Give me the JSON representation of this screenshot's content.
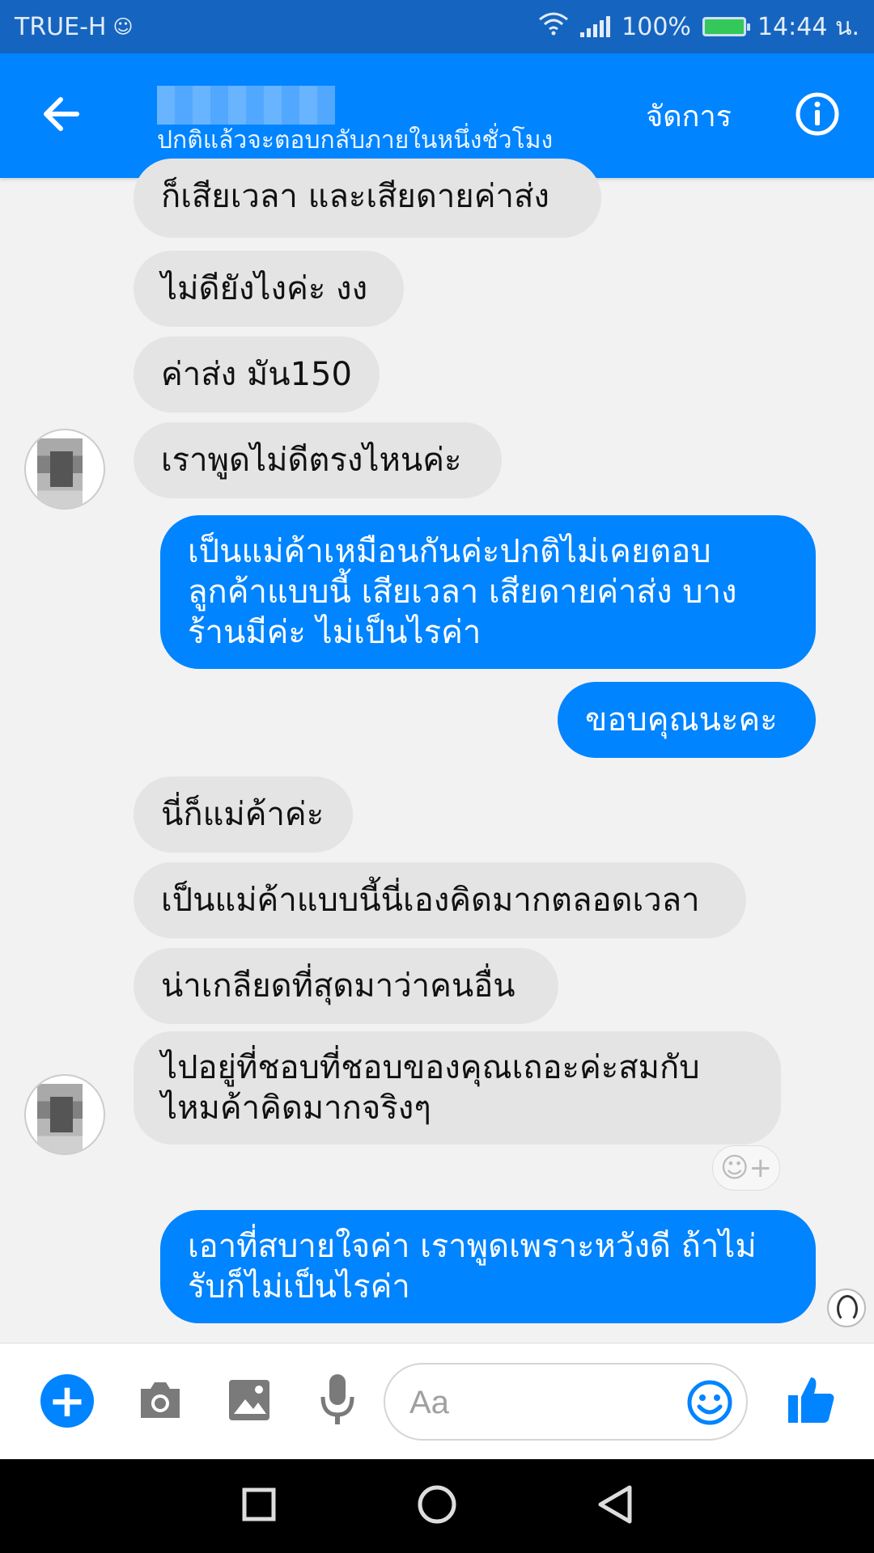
{
  "status_bar": {
    "carrier": "TRUE-H",
    "battery": "100%",
    "time": "14:44 น."
  },
  "header": {
    "subtitle": "ปกติแล้วจะตอบกลับภายในหนึ่งชั่วโมง",
    "manage_label": "จัดการ",
    "icons": [
      "back-arrow-icon",
      "info-icon"
    ]
  },
  "messages": [
    {
      "side": "in",
      "text": "ก็เสียเวลา และเสียดายค่าส่ง"
    },
    {
      "side": "in",
      "text": "ไม่ดียังไงค่ะ งง"
    },
    {
      "side": "in",
      "text": "ค่าส่ง มัน150"
    },
    {
      "side": "in",
      "text": "เราพูดไม่ดีตรงไหนค่ะ"
    },
    {
      "side": "out",
      "lines": [
        "เป็นแม่ค้าเหมือนกันค่ะปกติไม่เคยตอบ",
        "ลูกค้าแบบนี้ เสียเวลา เสียดายค่าส่ง บาง",
        "ร้านมีค่ะ ไม่เป็นไรค่า"
      ]
    },
    {
      "side": "out",
      "text": "ขอบคุณนะคะ"
    },
    {
      "side": "in",
      "text": "นี่ก็แม่ค้าค่ะ"
    },
    {
      "side": "in",
      "text": "เป็นแม่ค้าแบบนี้นี่เองคิดมากตลอดเวลา"
    },
    {
      "side": "in",
      "text": "น่าเกลียดที่สุดมาว่าคนอื่น"
    },
    {
      "side": "in",
      "lines": [
        "ไปอยู่ที่ชอบที่ชอบของคุณเถอะค่ะสมกับ",
        "ไหมค้าคิดมากจริงๆ"
      ]
    },
    {
      "side": "out",
      "lines": [
        "เอาที่สบายใจค่า เราพูดเพราะหวังดี ถ้าไม่",
        "รับก็ไม่เป็นไรค่า"
      ]
    }
  ],
  "composer": {
    "placeholder": "Aa",
    "icons": [
      "plus-icon",
      "camera-icon",
      "image-icon",
      "microphone-icon",
      "emoji-icon",
      "thumbs-up-icon"
    ]
  },
  "colors": {
    "status_bar": "#1565c0",
    "header": "#0084ff",
    "outgoing_bubble": "#0084ff",
    "incoming_bubble": "#e4e4e4",
    "background": "#f2f2f2"
  }
}
